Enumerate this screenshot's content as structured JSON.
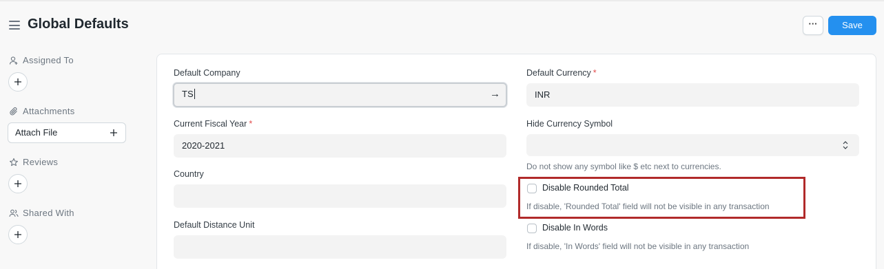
{
  "header": {
    "title": "Global Defaults",
    "more_label": "···",
    "save_label": "Save"
  },
  "sidebar": {
    "assigned_to": "Assigned To",
    "attachments": "Attachments",
    "attach_file": "Attach File",
    "reviews": "Reviews",
    "shared_with": "Shared With"
  },
  "form": {
    "default_company": {
      "label": "Default Company",
      "value": "TS"
    },
    "default_currency": {
      "label": "Default Currency",
      "value": "INR",
      "required": "*"
    },
    "current_fiscal_year": {
      "label": "Current Fiscal Year",
      "value": "2020-2021",
      "required": "*"
    },
    "hide_currency_symbol": {
      "label": "Hide Currency Symbol",
      "value": "",
      "description": "Do not show any symbol like $ etc next to currencies."
    },
    "country": {
      "label": "Country",
      "value": ""
    },
    "disable_rounded_total": {
      "label": "Disable Rounded Total",
      "checked": false,
      "description": "If disable, 'Rounded Total' field will not be visible in any transaction"
    },
    "default_distance_unit": {
      "label": "Default Distance Unit",
      "value": ""
    },
    "disable_in_words": {
      "label": "Disable In Words",
      "checked": false,
      "description": "If disable, 'In Words' field will not be visible in any transaction"
    }
  },
  "colors": {
    "primary": "#2490ef",
    "highlight": "#b12a2a",
    "required": "#e24c4c"
  }
}
